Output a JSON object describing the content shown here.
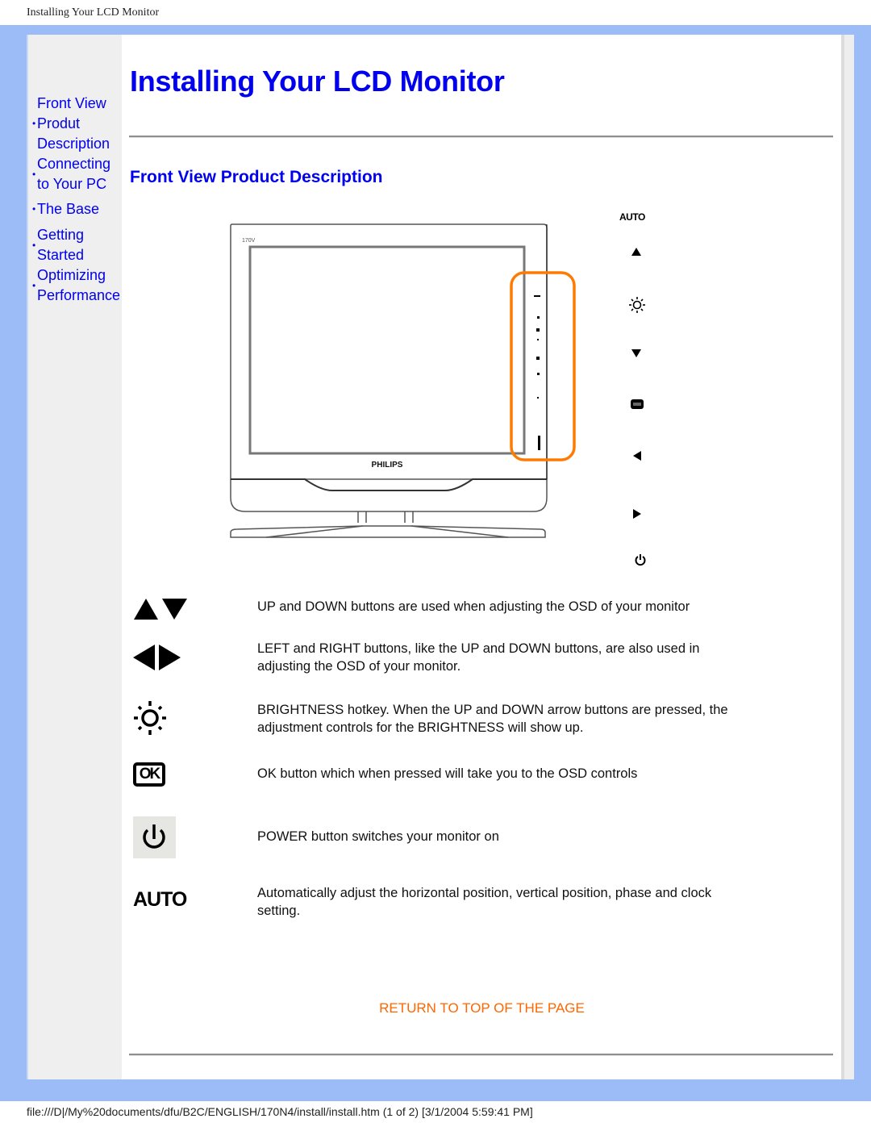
{
  "print_header": "Installing Your LCD Monitor",
  "print_footer": "file:///D|/My%20documents/dfu/B2C/ENGLISH/170N4/install/install.htm (1 of 2) [3/1/2004 5:59:41 PM]",
  "colors": {
    "frame": "#9bbcf7",
    "link": "#0000ee",
    "return_link": "#ff6600",
    "highlight": "#ff7a00",
    "sidebar_bg": "#efefef"
  },
  "sidebar": {
    "items": [
      {
        "label_line1": "Front View",
        "label_line2": "",
        "bullet": false
      },
      {
        "label_line1": "Produt",
        "label_line2": "Description",
        "bullet": true
      },
      {
        "label_line1": "Connecting",
        "label_line2": "to Your PC",
        "bullet": true
      },
      {
        "label_line1": "The Base",
        "label_line2": "",
        "bullet": true
      },
      {
        "label_line1": "Getting",
        "label_line2": "Started",
        "bullet": true
      },
      {
        "label_line1": "Optimizing",
        "label_line2": "Performance",
        "bullet": true
      }
    ]
  },
  "main": {
    "title": "Installing Your LCD Monitor",
    "section_title": "Front View Product Description",
    "monitor": {
      "brand": "PHILIPS",
      "model_label": "170V"
    },
    "button_legend": [
      {
        "icon": "auto-label",
        "label": "AUTO"
      },
      {
        "icon": "up-arrow-icon"
      },
      {
        "icon": "brightness-icon"
      },
      {
        "icon": "down-arrow-icon"
      },
      {
        "icon": "ok-icon"
      },
      {
        "icon": "left-arrow-icon"
      },
      {
        "icon": "right-arrow-icon"
      },
      {
        "icon": "power-icon"
      }
    ],
    "descriptions": [
      {
        "icon": "up-down-arrows-icon",
        "text": "UP and DOWN buttons are used when adjusting the OSD of your monitor"
      },
      {
        "icon": "left-right-arrows-icon",
        "text": "LEFT and RIGHT buttons, like the UP and DOWN buttons, are also used in adjusting the OSD of your monitor."
      },
      {
        "icon": "brightness-icon",
        "text": "BRIGHTNESS hotkey. When the UP and DOWN arrow buttons are pressed, the adjustment controls for the BRIGHTNESS will show up."
      },
      {
        "icon": "ok-icon",
        "icon_text": "OK",
        "text": "OK button which when pressed will take you to the OSD controls"
      },
      {
        "icon": "power-icon",
        "text": "POWER button switches your monitor on"
      },
      {
        "icon": "auto-icon",
        "icon_text": "AUTO",
        "text": "Automatically adjust the horizontal position, vertical position, phase and clock setting."
      }
    ],
    "return_link": "RETURN TO TOP OF THE PAGE"
  }
}
